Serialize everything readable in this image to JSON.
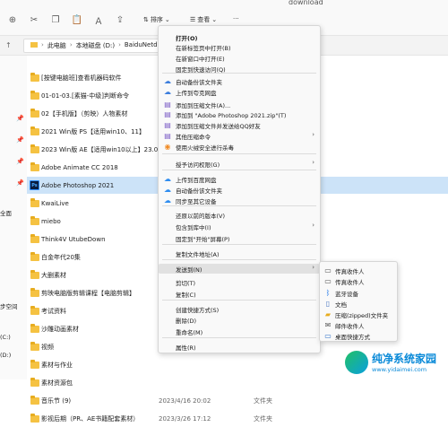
{
  "window": {
    "title_partial": "download"
  },
  "toolbar": {
    "sort_label": "排序",
    "view_label": "查看",
    "more_label": "···"
  },
  "address": {
    "crumbs": [
      "此电脑",
      "本地磁盘 (D:)",
      "BaiduNetdiskDo"
    ]
  },
  "sidebar": {
    "texts": [
      "全面",
      "步空间",
      "(C:)",
      "(D:)"
    ]
  },
  "files": [
    {
      "name": "[按键电脑班]查看机器码软件",
      "date": "",
      "type": ""
    },
    {
      "name": "01-01-03.[素猫-中级]判断命令",
      "date": "",
      "type": ""
    },
    {
      "name": "02【手机版】（剪映）人物素材",
      "date": "",
      "type": ""
    },
    {
      "name": "2021 Win版 PS【适用win10、11】",
      "date": "",
      "type": ""
    },
    {
      "name": "2023 Win版 AE【适用win10以上】23.0",
      "date": "",
      "type": ""
    },
    {
      "name": "Adobe Animate CC 2018",
      "date": "",
      "type": ""
    },
    {
      "name": "Adobe Photoshop 2021",
      "date": "",
      "type": "",
      "selected": true,
      "icon": "photoshop"
    },
    {
      "name": "KwaiLive",
      "date": "",
      "type": ""
    },
    {
      "name": "miebo",
      "date": "",
      "type": ""
    },
    {
      "name": "Think4V UtubeDown",
      "date": "",
      "type": ""
    },
    {
      "name": "白金年代20集",
      "date": "",
      "type": ""
    },
    {
      "name": "大删素材",
      "date": "",
      "type": ""
    },
    {
      "name": "剪映电脑版剪辑课程【电脑剪辑】",
      "date": "",
      "type": ""
    },
    {
      "name": "考试资料",
      "date": "",
      "type": ""
    },
    {
      "name": "沙雕动画素材",
      "date": "",
      "type": ""
    },
    {
      "name": "视频",
      "date": "",
      "type": ""
    },
    {
      "name": "素材与作业",
      "date": "",
      "type": ""
    },
    {
      "name": "素材资源包",
      "date": "",
      "type": ""
    },
    {
      "name": "音乐节 (9)",
      "date": "2023/4/16 20:02",
      "type": "文件夹"
    },
    {
      "name": "影视后期（PR、AE书籍配套素材）",
      "date": "2023/3/26 17:12",
      "type": "文件夹"
    }
  ],
  "context_menu": {
    "items": [
      {
        "label": "打开(O)",
        "bold": true,
        "icon": ""
      },
      {
        "label": "在新标签页中打开(B)",
        "icon": ""
      },
      {
        "label": "在新窗口中打开(E)",
        "icon": ""
      },
      {
        "label": "固定到快速访问(Q)",
        "icon": ""
      },
      {
        "label": "自动备份该文件夹",
        "icon": "cloud"
      },
      {
        "label": "上传到夸克网盘",
        "icon": "cloud"
      },
      {
        "label": "添加到压缩文件(A)...",
        "icon": "archive"
      },
      {
        "label": "添加到 \"Adobe Photoshop 2021.zip\"(T)",
        "icon": "archive"
      },
      {
        "label": "添加到压缩文件并发送给QQ好友",
        "icon": "archive"
      },
      {
        "label": "其他压缩命令",
        "icon": "archive",
        "submenu": true
      },
      {
        "label": "使用火绒安全进行杀毒",
        "icon": "shield"
      },
      {
        "label": "授予访问权限(G)",
        "icon": "",
        "submenu": true
      },
      {
        "label": "上传到百度网盘",
        "icon": "baidu"
      },
      {
        "label": "自动备份该文件夹",
        "icon": "baidu"
      },
      {
        "label": "同步至其它设备",
        "icon": "baidu"
      },
      {
        "label": "还原以前的版本(V)",
        "icon": ""
      },
      {
        "label": "包含到库中(I)",
        "icon": "",
        "submenu": true
      },
      {
        "label": "固定到\"开始\"屏幕(P)",
        "icon": ""
      },
      {
        "label": "复制文件地址(A)",
        "icon": ""
      },
      {
        "label": "发送到(N)",
        "icon": "",
        "submenu": true,
        "highlighted": true
      },
      {
        "label": "剪切(T)",
        "icon": ""
      },
      {
        "label": "复制(C)",
        "icon": ""
      },
      {
        "label": "创建快捷方式(S)",
        "icon": ""
      },
      {
        "label": "删除(D)",
        "icon": ""
      },
      {
        "label": "重命名(M)",
        "icon": ""
      },
      {
        "label": "属性(R)",
        "icon": ""
      }
    ]
  },
  "send_to_menu": {
    "items": [
      {
        "label": "传真收件人",
        "icon": "fax"
      },
      {
        "label": "传真收件人",
        "icon": "fax"
      },
      {
        "label": "蓝牙设备",
        "icon": "bluetooth"
      },
      {
        "label": "文档",
        "icon": "document"
      },
      {
        "label": "压缩(zipped)文件夹",
        "icon": "zip-folder"
      },
      {
        "label": "邮件收件人",
        "icon": "mail"
      },
      {
        "label": "桌面快捷方式",
        "icon": "desktop"
      }
    ]
  },
  "watermark": {
    "title": "纯净系统家园",
    "url": "www.yidaimei.com"
  },
  "colors": {
    "selection": "#cce3f8",
    "folder": "#f5c242",
    "menu_bg": "#f9f9f9",
    "menu_highlight": "#e1e1e1"
  }
}
